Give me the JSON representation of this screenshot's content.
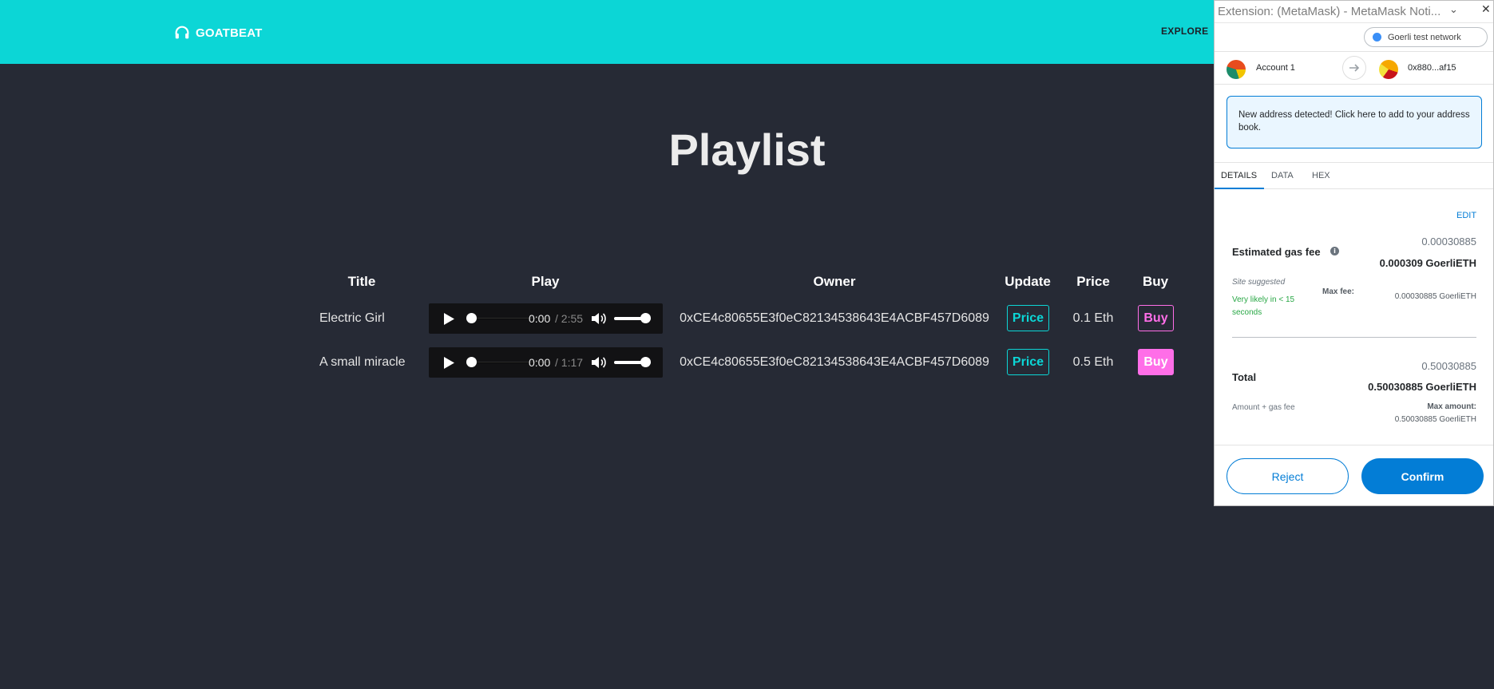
{
  "app": {
    "brand": "GOATBEAT",
    "nav_explore": "EXPLORE",
    "page_title": "Playlist",
    "accent": "#0cd6d6",
    "buy_accent": "#ff6ee8"
  },
  "table": {
    "headers": [
      "Title",
      "Play",
      "Owner",
      "Update",
      "Price",
      "Buy"
    ],
    "rows": [
      {
        "title": "Electric Girl",
        "time_current": "0:00",
        "time_total": "/ 2:55",
        "owner": "0xCE4c80655E3f0eC82134538643E4ACBF457D6089",
        "update_label": "Price",
        "price": "0.1 Eth",
        "buy_label": "Buy",
        "buy_filled": false
      },
      {
        "title": "A small miracle",
        "time_current": "0:00",
        "time_total": "/ 1:17",
        "owner": "0xCE4c80655E3f0eC82134538643E4ACBF457D6089",
        "update_label": "Price",
        "price": "0.5 Eth",
        "buy_label": "Buy",
        "buy_filled": true
      }
    ]
  },
  "metamask": {
    "window_title": "Extension: (MetaMask) - MetaMask Noti...",
    "network": "Goerli test network",
    "from_account": "Account 1",
    "to_account": "0x880...af15",
    "notice": "New address detected! Click here to add to your address book.",
    "tabs": [
      "DETAILS",
      "DATA",
      "HEX"
    ],
    "edit_label": "EDIT",
    "gas": {
      "label": "Estimated gas fee",
      "secondary": "0.00030885",
      "primary": "0.000309 GoerliETH",
      "site_suggested": "Site suggested",
      "likely": "Very likely in < 15 seconds",
      "max_fee_label": "Max fee:",
      "max_fee_value": "0.00030885 GoerliETH"
    },
    "total": {
      "label": "Total",
      "secondary": "0.50030885",
      "primary": "0.50030885 GoerliETH",
      "amount_gas": "Amount + gas fee",
      "max_amount_label": "Max amount:",
      "max_amount_value": "0.50030885 GoerliETH"
    },
    "reject_label": "Reject",
    "confirm_label": "Confirm",
    "primary_color": "#037dd6"
  }
}
